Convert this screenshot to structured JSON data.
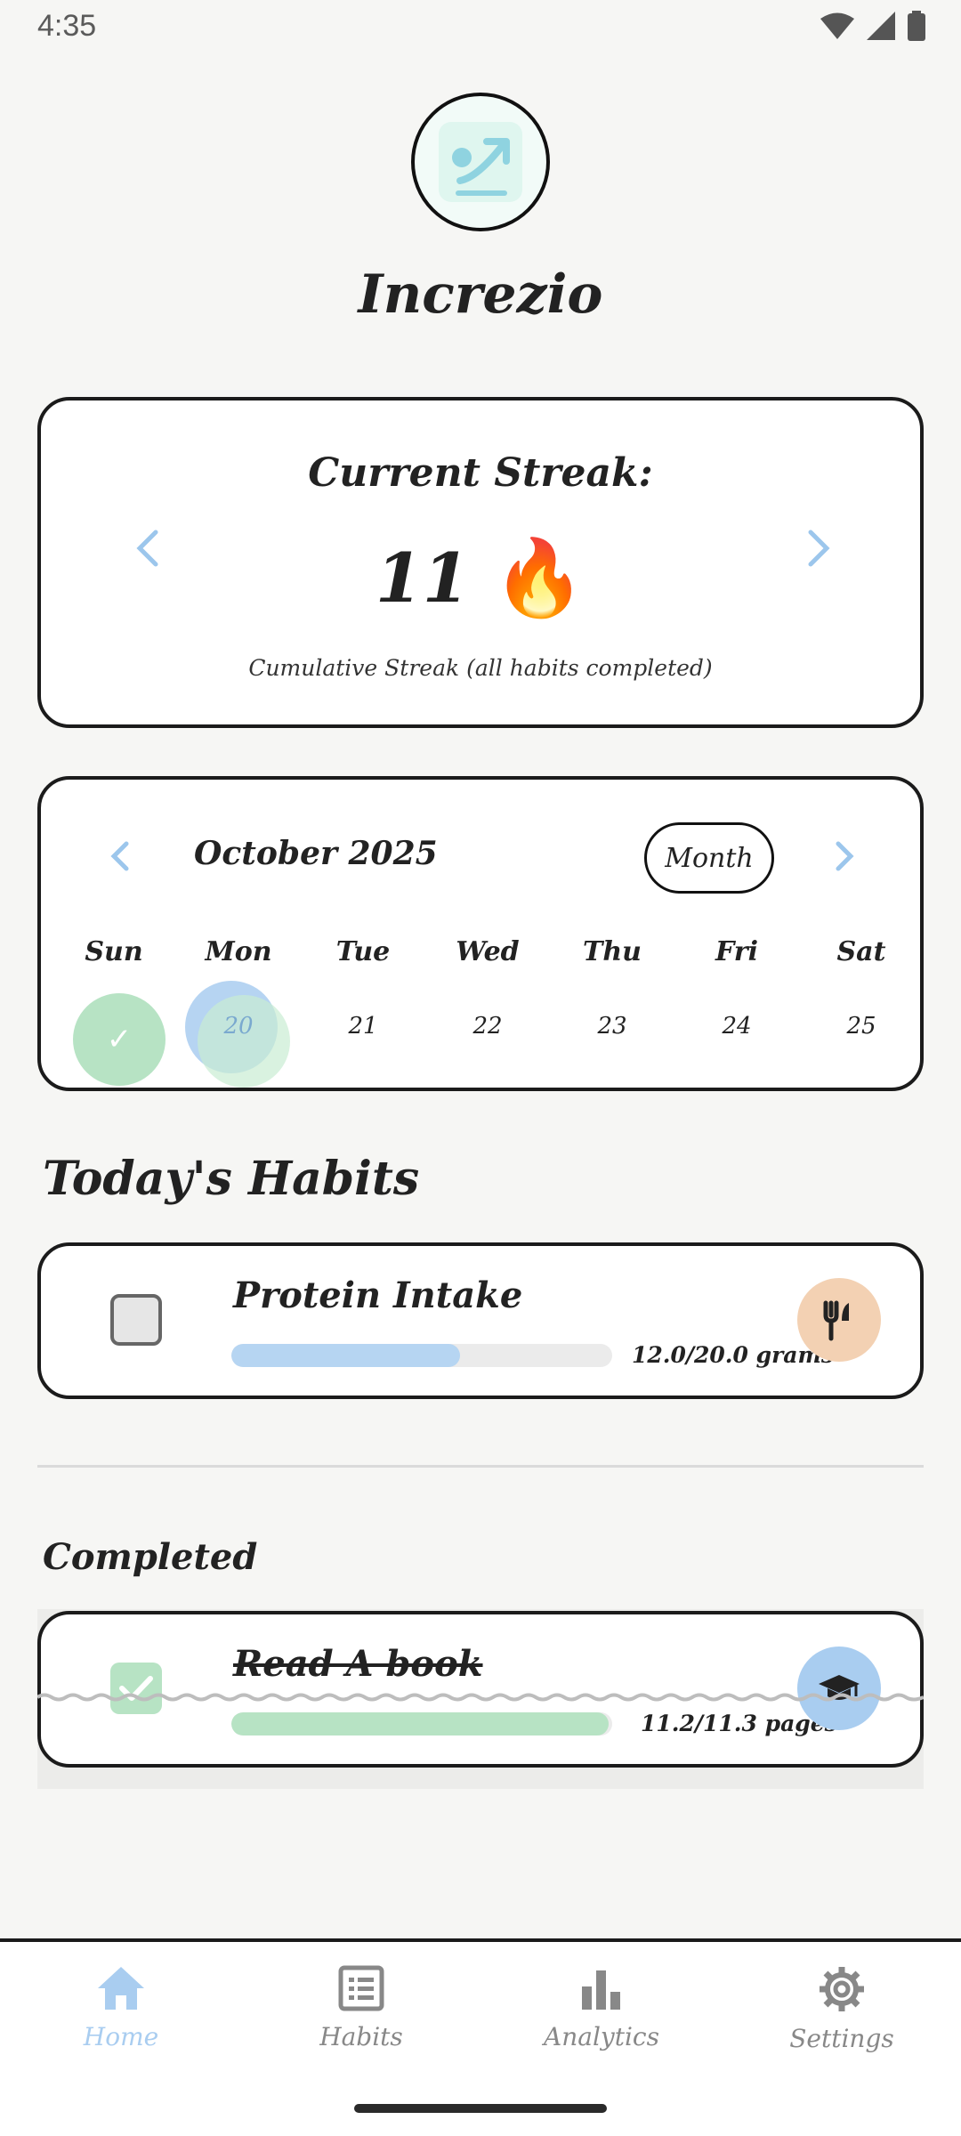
{
  "status_bar": {
    "time": "4:35"
  },
  "app": {
    "title": "Increzio"
  },
  "streak": {
    "title": "Current Streak:",
    "value": "11",
    "emoji": "🔥",
    "subtitle": "Cumulative Streak (all habits completed)"
  },
  "calendar": {
    "month_label": "October 2025",
    "view_button": "Month",
    "weekdays": [
      "Sun",
      "Mon",
      "Tue",
      "Wed",
      "Thu",
      "Fri",
      "Sat"
    ],
    "days": [
      "20",
      "21",
      "22",
      "23",
      "24",
      "25"
    ],
    "sunday_done_mark": "✓"
  },
  "todays_habits": {
    "title": "Today's Habits",
    "items": [
      {
        "name": "Protein Intake",
        "progress_text": "12.0/20.0 grams",
        "progress": 0.6,
        "icon": "utensils-icon"
      }
    ]
  },
  "completed": {
    "title": "Completed",
    "items": [
      {
        "name": "Read A book",
        "progress_text": "11.2/11.3 pages",
        "progress": 0.99,
        "icon": "graduation-cap-icon"
      }
    ]
  },
  "nav": {
    "items": [
      {
        "label": "Home",
        "icon": "home-icon",
        "active": true
      },
      {
        "label": "Habits",
        "icon": "list-icon",
        "active": false
      },
      {
        "label": "Analytics",
        "icon": "bar-chart-icon",
        "active": false
      },
      {
        "label": "Settings",
        "icon": "gear-icon",
        "active": false
      }
    ]
  },
  "colors": {
    "accent_blue": "#a9cdf0",
    "accent_green": "#b7e3c4",
    "accent_peach": "#f3d1b3",
    "chevron": "#9cc6ec"
  }
}
